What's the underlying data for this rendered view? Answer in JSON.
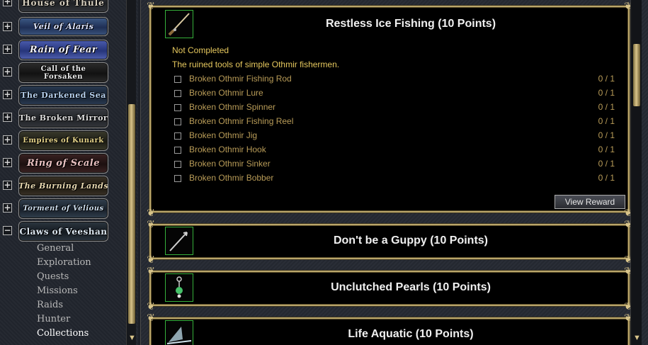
{
  "sidebar": {
    "expansions": [
      {
        "name": "House of Thule",
        "expanded": false
      },
      {
        "name": "Veil of Alaris",
        "expanded": false
      },
      {
        "name": "Rain of Fear",
        "expanded": false
      },
      {
        "name": "Call of the Forsaken",
        "expanded": false
      },
      {
        "name": "The Darkened Sea",
        "expanded": false
      },
      {
        "name": "The Broken Mirror",
        "expanded": false
      },
      {
        "name": "Empires of Kunark",
        "expanded": false
      },
      {
        "name": "Ring of Scale",
        "expanded": false
      },
      {
        "name": "The Burning Lands",
        "expanded": false
      },
      {
        "name": "Torment of Velious",
        "expanded": false
      },
      {
        "name": "Claws of Veeshan",
        "expanded": true
      }
    ],
    "expander_collapsed": "+",
    "expander_expanded": "−",
    "categories": [
      "General",
      "Exploration",
      "Quests",
      "Missions",
      "Raids",
      "Hunter",
      "Collections"
    ],
    "selected_category": "Collections"
  },
  "achievements": [
    {
      "title": "Restless Ice Fishing (10 Points)",
      "icon": "fishing-rod-icon",
      "expanded": true,
      "status": "Not Completed",
      "description": "The ruined tools of simple Othmir fishermen.",
      "tasks": [
        {
          "name": "Broken Othmir Fishing Rod",
          "progress": "0 / 1"
        },
        {
          "name": "Broken Othmir Lure",
          "progress": "0 / 1"
        },
        {
          "name": "Broken Othmir Spinner",
          "progress": "0 / 1"
        },
        {
          "name": "Broken Othmir Fishing Reel",
          "progress": "0 / 1"
        },
        {
          "name": "Broken Othmir Jig",
          "progress": "0 / 1"
        },
        {
          "name": "Broken Othmir Hook",
          "progress": "0 / 1"
        },
        {
          "name": "Broken Othmir Sinker",
          "progress": "0 / 1"
        },
        {
          "name": "Broken Othmir Bobber",
          "progress": "0 / 1"
        }
      ],
      "reward_button": "View Reward"
    },
    {
      "title": "Don't be a Guppy (10 Points)",
      "icon": "fish-spear-icon",
      "expanded": false
    },
    {
      "title": "Unclutched Pearls (10 Points)",
      "icon": "pearl-earring-icon",
      "expanded": false
    },
    {
      "title": "Life Aquatic (10 Points)",
      "icon": "shark-fin-icon",
      "expanded": false
    }
  ],
  "colors": {
    "panel_border": "#b9a56a",
    "icon_border": "#35b03a",
    "status_text": "#e6c85e",
    "task_text": "#b99c58"
  }
}
